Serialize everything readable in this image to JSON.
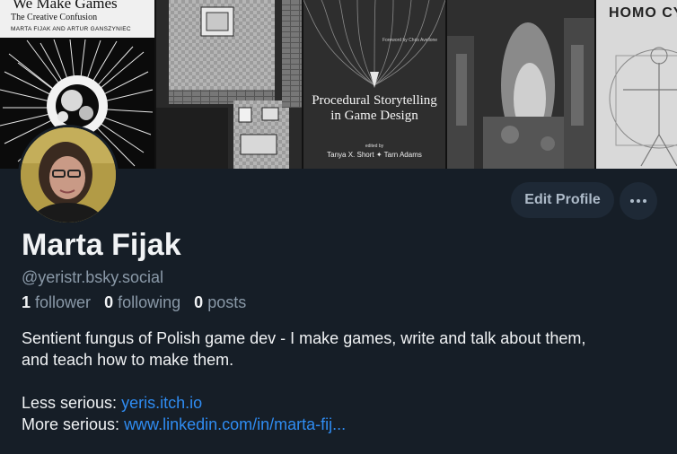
{
  "banner": {
    "book1": {
      "title": "We Make Games",
      "subtitle": "The Creative Confusion",
      "authors": "MARTA FIJAK AND ARTUR GANSZYNIEC"
    },
    "book3": {
      "title_line1": "Procedural Storytelling",
      "title_line2": "in Game Design",
      "foreword": "Foreword by Chris Avellone",
      "edited_by": "edited by",
      "authors": "Tanya X. Short ✦ Tarn Adams"
    },
    "book5": {
      "title": "HOMO CYB"
    }
  },
  "profile": {
    "display_name": "Marta Fijak",
    "handle": "@yeristr.bsky.social",
    "followers_count": "1",
    "followers_label": "follower",
    "following_count": "0",
    "following_label": "following",
    "posts_count": "0",
    "posts_label": "posts",
    "bio_line1": "Sentient fungus of Polish game dev - I make games, write and talk about them,",
    "bio_line2": "and teach how to make them.",
    "less_serious_label": "Less serious:",
    "less_serious_link": "yeris.itch.io",
    "more_serious_label": "More serious:",
    "more_serious_link": "www.linkedin.com/in/marta-fij..."
  },
  "actions": {
    "edit_profile": "Edit Profile",
    "more_icon": "ellipsis-icon"
  },
  "colors": {
    "background": "#161e27",
    "button_bg": "#1e2936",
    "link": "#2f8cf2",
    "muted_text": "#8a99a8"
  }
}
